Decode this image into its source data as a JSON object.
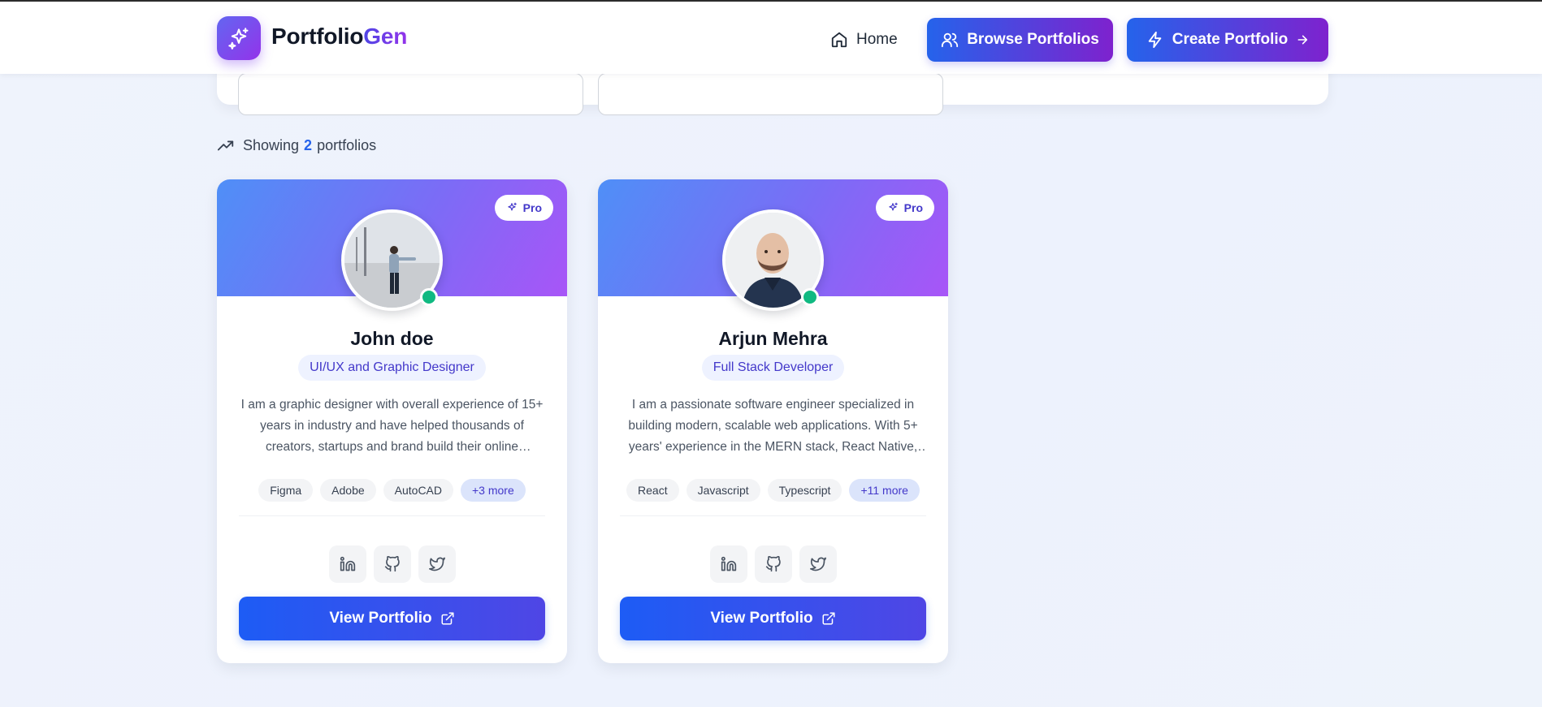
{
  "header": {
    "logo_part1": "Portfolio",
    "logo_part2": "Gen",
    "logo_icon": "sparkles-icon",
    "nav_home": "Home",
    "browse_label": "Browse Portfolios",
    "create_label": "Create Portfolio"
  },
  "results": {
    "prefix": "Showing",
    "count": "2",
    "suffix": "portfolios"
  },
  "cards": [
    {
      "badge": "Pro",
      "name": "John doe",
      "role": "UI/UX and Graphic Designer",
      "bio": "I am a graphic designer with overall experience of 15+ years in industry and have helped thousands of creators, startups and brand build their online presence",
      "skills": [
        "Figma",
        "Adobe",
        "AutoCAD",
        "+3 more"
      ],
      "button": "View Portfolio"
    },
    {
      "badge": "Pro",
      "name": "Arjun Mehra",
      "role": "Full Stack Developer",
      "bio": "I am a passionate software engineer specialized in building modern, scalable web applications. With 5+ years' experience in the MERN stack, React Native, and cloud technologies",
      "skills": [
        "React",
        "Javascript",
        "Typescript",
        "+11 more"
      ],
      "button": "View Portfolio"
    }
  ],
  "colors": {
    "accent": "#4f46e5",
    "brand_gradient_start": "#2563eb",
    "brand_gradient_end": "#7e22ce",
    "online": "#10b981"
  }
}
